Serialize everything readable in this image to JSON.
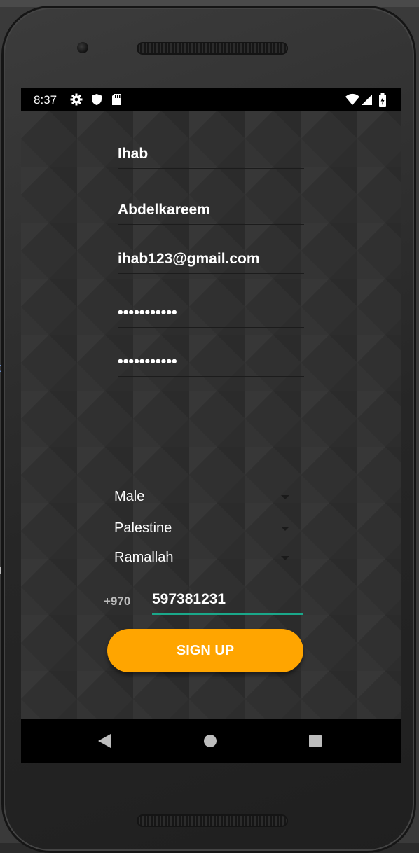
{
  "status_bar": {
    "time": "8:37",
    "left_icons": [
      "gear-icon",
      "shield-icon",
      "sd-card-icon"
    ],
    "right_icons": [
      "wifi-icon",
      "cell-signal-icon",
      "battery-icon"
    ]
  },
  "form": {
    "first_name": "Ihab",
    "last_name": "Abdelkareem",
    "email": "ihab123@gmail.com",
    "password": "•••••••••••",
    "confirm_password": "•••••••••••",
    "gender": "Male",
    "country": "Palestine",
    "city": "Ramallah",
    "phone_prefix": "+970",
    "phone_number": "597381231",
    "signup_label": "SIGN UP"
  },
  "colors": {
    "accent": "#ffa500",
    "input_underline_focused": "#1aa88a",
    "text": "#ffffff"
  },
  "nav_bar": {
    "buttons": [
      "back-icon",
      "home-icon",
      "recents-icon"
    ]
  }
}
